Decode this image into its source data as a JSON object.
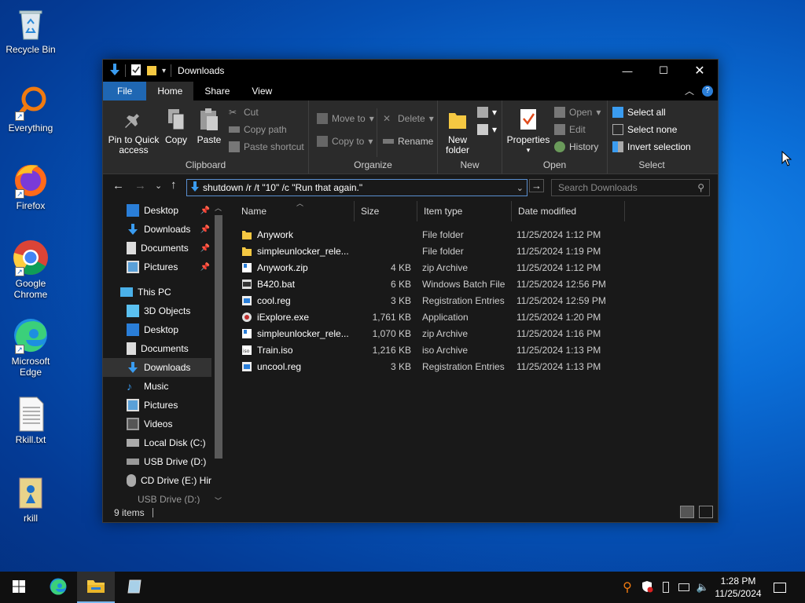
{
  "desktop": {
    "icons": [
      {
        "label": "Recycle Bin"
      },
      {
        "label": "Everything"
      },
      {
        "label": "Firefox"
      },
      {
        "label": "Google Chrome"
      },
      {
        "label": "Microsoft Edge"
      },
      {
        "label": "Rkill.txt"
      },
      {
        "label": "rkill"
      }
    ]
  },
  "window": {
    "title": "Downloads",
    "tabs": [
      "File",
      "Home",
      "Share",
      "View"
    ],
    "ribbon": {
      "clipboard": {
        "label": "Clipboard",
        "pin_line1": "Pin to Quick",
        "pin_line2": "access",
        "copy": "Copy",
        "paste": "Paste",
        "cut": "Cut",
        "copy_path": "Copy path",
        "paste_shortcut": "Paste shortcut"
      },
      "organize": {
        "label": "Organize",
        "move_to": "Move to",
        "copy_to": "Copy to",
        "delete": "Delete",
        "rename": "Rename"
      },
      "new": {
        "label": "New",
        "new_folder_line1": "New",
        "new_folder_line2": "folder"
      },
      "open": {
        "label": "Open",
        "properties": "Properties",
        "open": "Open",
        "edit": "Edit",
        "history": "History"
      },
      "select": {
        "label": "Select",
        "select_all": "Select all",
        "select_none": "Select none",
        "invert": "Invert selection"
      }
    },
    "address": {
      "value": "shutdown /r /t \"10\" /c \"Run that again.\""
    },
    "search": {
      "placeholder": "Search Downloads"
    },
    "nav": {
      "quick": [
        {
          "label": "Desktop"
        },
        {
          "label": "Downloads"
        },
        {
          "label": "Documents"
        },
        {
          "label": "Pictures"
        }
      ],
      "this_pc": "This PC",
      "pc_items": [
        {
          "label": "3D Objects"
        },
        {
          "label": "Desktop"
        },
        {
          "label": "Documents"
        },
        {
          "label": "Downloads"
        },
        {
          "label": "Music"
        },
        {
          "label": "Pictures"
        },
        {
          "label": "Videos"
        },
        {
          "label": "Local Disk (C:)"
        },
        {
          "label": "USB Drive (D:)"
        },
        {
          "label": "CD Drive (E:) Hir"
        },
        {
          "label": "USB Drive (D:)"
        }
      ]
    },
    "columns": {
      "name": "Name",
      "size": "Size",
      "type": "Item type",
      "date": "Date modified"
    },
    "files": [
      {
        "name": "Anywork",
        "size": "",
        "type": "File folder",
        "date": "11/25/2024 1:12 PM",
        "icon": "folder"
      },
      {
        "name": "simpleunlocker_rele...",
        "size": "",
        "type": "File folder",
        "date": "11/25/2024 1:19 PM",
        "icon": "folder"
      },
      {
        "name": "Anywork.zip",
        "size": "4 KB",
        "type": "zip Archive",
        "date": "11/25/2024 1:12 PM",
        "icon": "zip"
      },
      {
        "name": "B420.bat",
        "size": "6 KB",
        "type": "Windows Batch File",
        "date": "11/25/2024 12:56 PM",
        "icon": "bat"
      },
      {
        "name": "cool.reg",
        "size": "3 KB",
        "type": "Registration Entries",
        "date": "11/25/2024 12:59 PM",
        "icon": "reg"
      },
      {
        "name": "iExplore.exe",
        "size": "1,761 KB",
        "type": "Application",
        "date": "11/25/2024 1:20 PM",
        "icon": "exe"
      },
      {
        "name": "simpleunlocker_rele...",
        "size": "1,070 KB",
        "type": "zip Archive",
        "date": "11/25/2024 1:16 PM",
        "icon": "zip"
      },
      {
        "name": "Train.iso",
        "size": "1,216 KB",
        "type": "iso Archive",
        "date": "11/25/2024 1:13 PM",
        "icon": "iso"
      },
      {
        "name": "uncool.reg",
        "size": "3 KB",
        "type": "Registration Entries",
        "date": "11/25/2024 1:13 PM",
        "icon": "reg"
      }
    ],
    "status": {
      "items": "9 items"
    }
  },
  "taskbar": {
    "time": "1:28 PM",
    "date": "11/25/2024"
  },
  "colors": {
    "accent": "#1f67b3",
    "window_bg": "#191919",
    "ribbon_bg": "#2b2b2b",
    "taskbar": "#101010"
  }
}
